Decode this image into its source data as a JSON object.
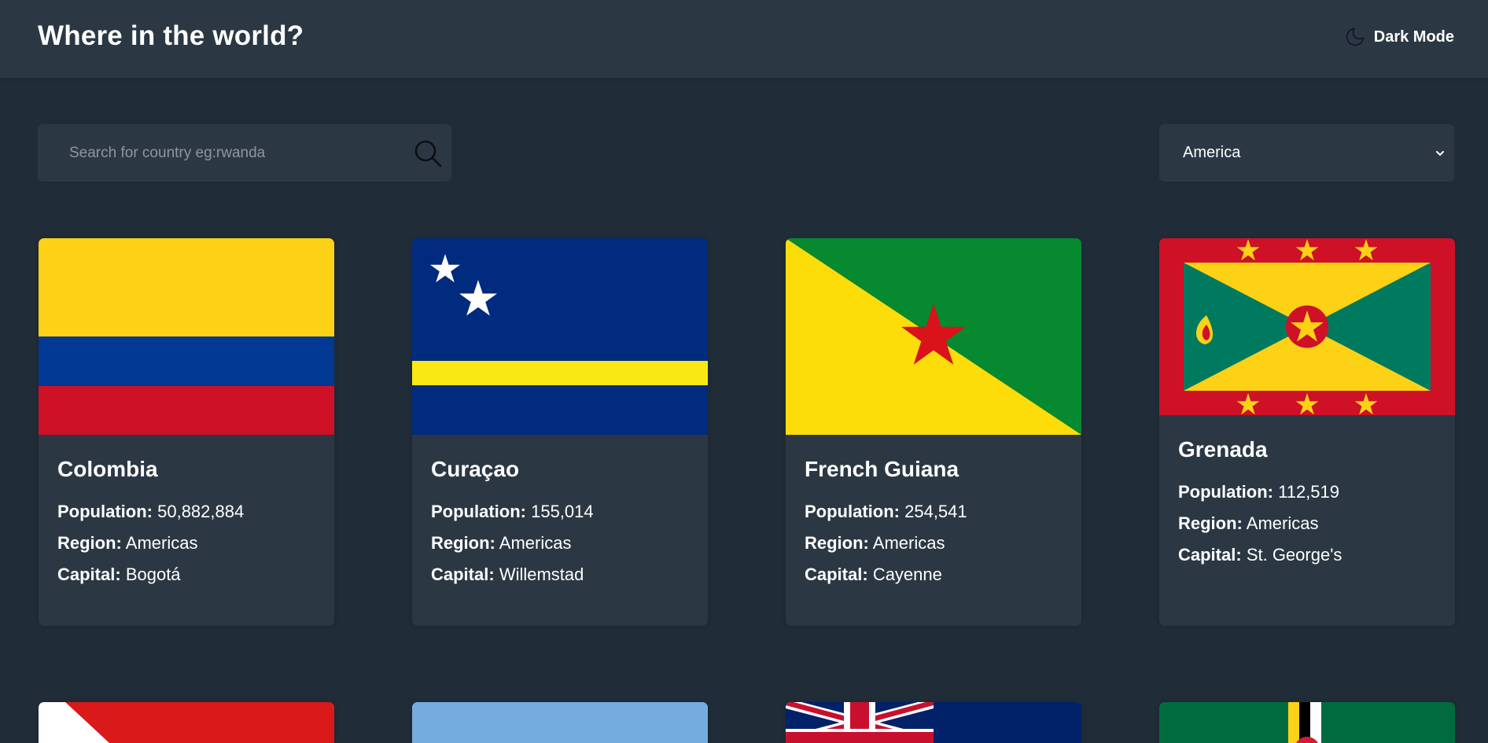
{
  "header": {
    "title": "Where in the world?",
    "theme_toggle_label": "Dark Mode"
  },
  "search": {
    "placeholder": "Search for country eg:rwanda",
    "value": ""
  },
  "filter": {
    "selected": "America"
  },
  "labels": {
    "population": "Population:",
    "region": "Region:",
    "capital": "Capital:"
  },
  "countries": [
    {
      "name": "Colombia",
      "population": "50,882,884",
      "region": "Americas",
      "capital": "Bogotá"
    },
    {
      "name": "Curaçao",
      "population": "155,014",
      "region": "Americas",
      "capital": "Willemstad"
    },
    {
      "name": "French Guiana",
      "population": "254,541",
      "region": "Americas",
      "capital": "Cayenne"
    },
    {
      "name": "Grenada",
      "population": "112,519",
      "region": "Americas",
      "capital": "St. George's"
    }
  ],
  "partially_visible_flags": [
    "trinidad-and-tobago-flag",
    "argentina-flag",
    "falkland-islands-flag",
    "dominica-flag"
  ],
  "colors": {
    "background": "#202c37",
    "surface": "#2b3844",
    "text": "#ffffff",
    "placeholder": "#8f959b"
  },
  "icons": {
    "theme": "moon-icon",
    "search": "search-icon",
    "dropdown": "chevron-down-icon"
  }
}
